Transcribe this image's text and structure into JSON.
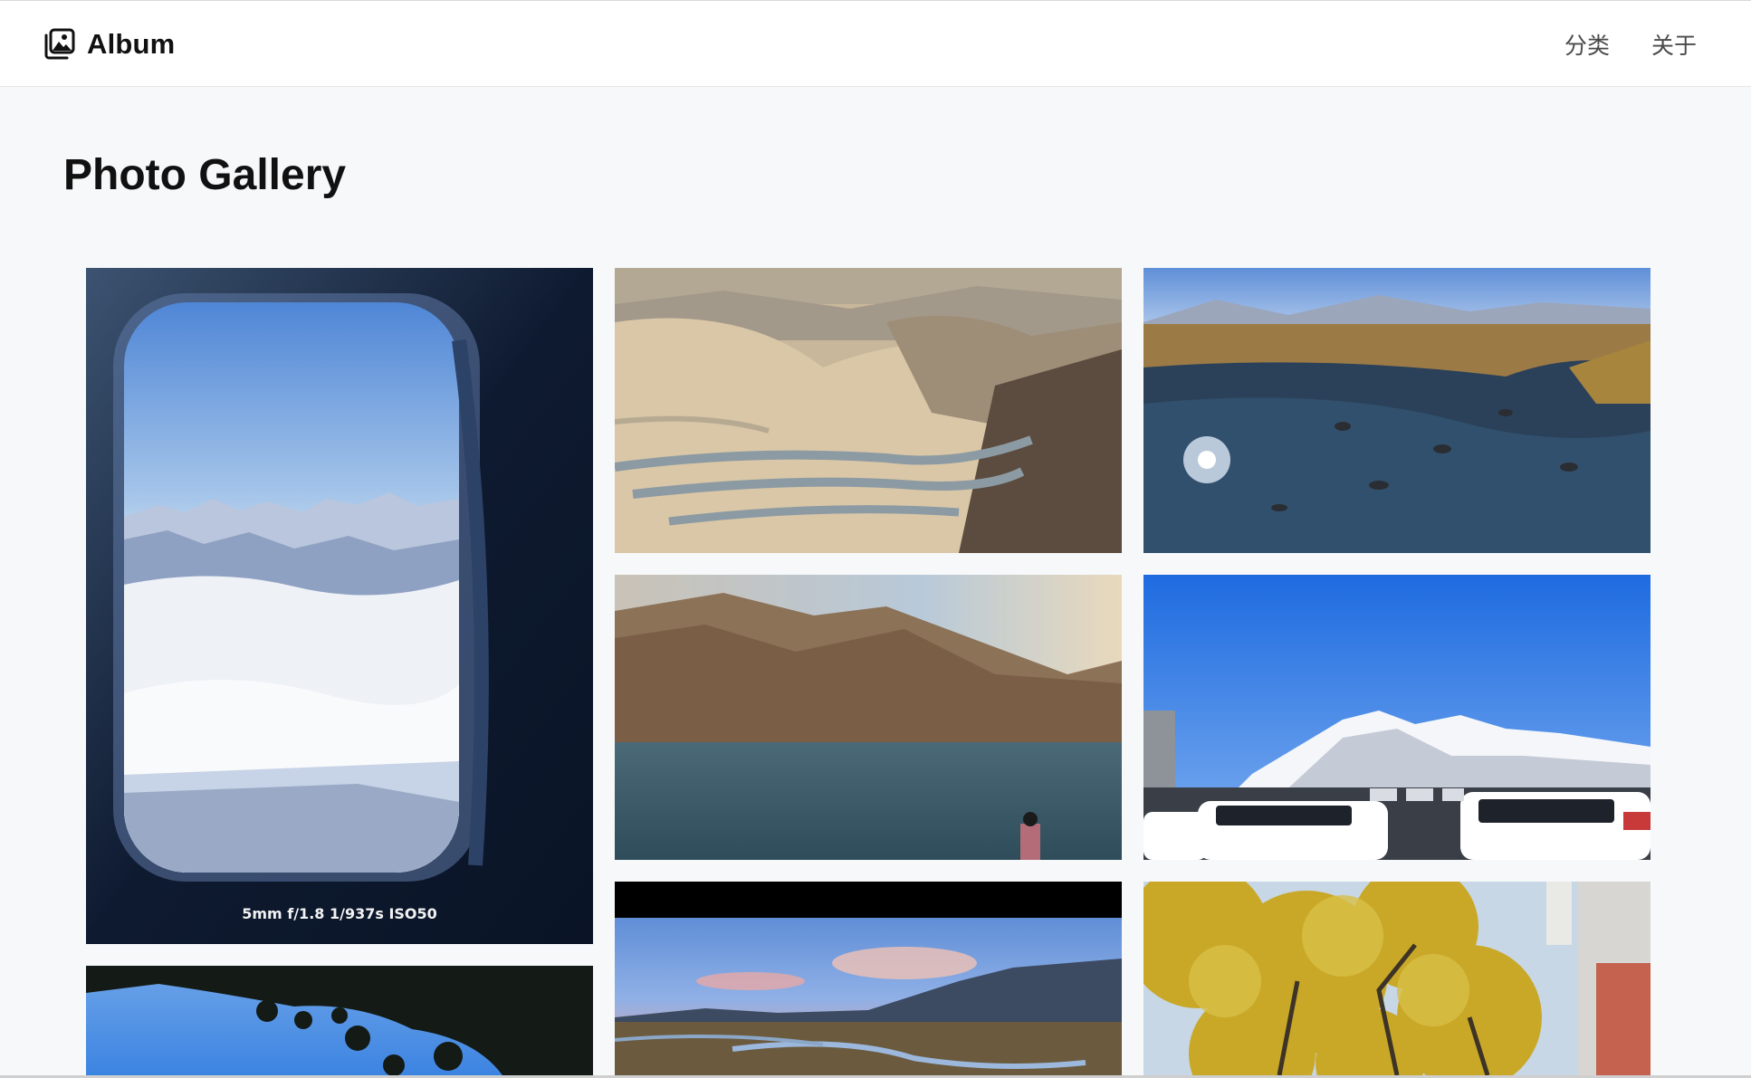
{
  "header": {
    "brand": "Album",
    "brand_icon": "photo-album-icon",
    "nav": [
      {
        "label": "分类"
      },
      {
        "label": "关于"
      }
    ]
  },
  "main": {
    "title": "Photo Gallery",
    "photos": [
      {
        "subject": "airplane window above clouds and snowy mountains",
        "caption": "5mm f/1.8 1/937s ISO50"
      },
      {
        "subject": "desert mountain switchback road"
      },
      {
        "subject": "alpine stream in grassland"
      },
      {
        "subject": "mountain lake with a person"
      },
      {
        "subject": "snow mountain and parking lot"
      },
      {
        "subject": "pine tree against blue sky"
      },
      {
        "subject": "sunset over river valley and mountains"
      },
      {
        "subject": "yellow ginkgo trees"
      }
    ]
  },
  "colors": {
    "background": "#f7f8fa",
    "navbar": "#ffffff",
    "text": "#111111",
    "nav_text": "#4a4a4a"
  }
}
